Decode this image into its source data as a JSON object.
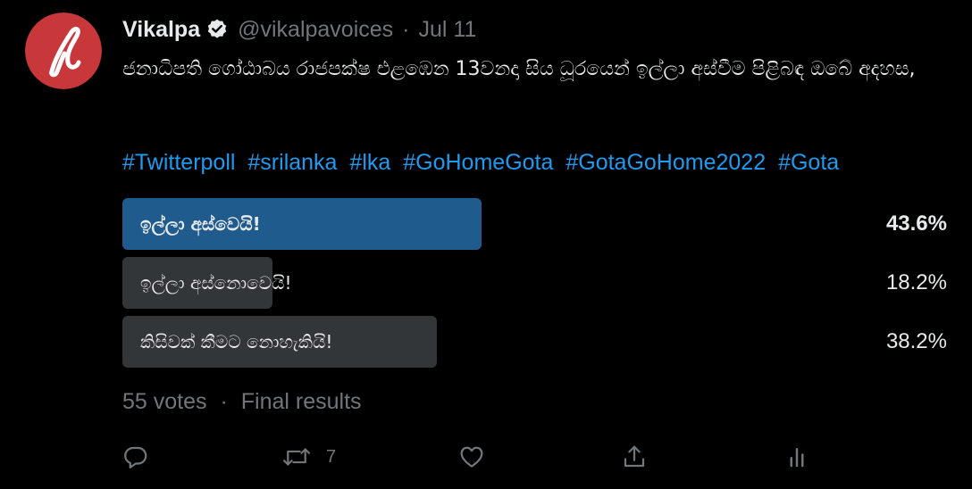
{
  "account": {
    "name": "Vikalpa",
    "handle": "@vikalpavoices",
    "separator": "·",
    "date": "Jul 11",
    "verified": true,
    "avatar_color": "#c8373a"
  },
  "tweet": {
    "text": "ජනාධිපති ගෝඨාබය රාජපක්ෂ  එළඹෙන 13වනදා සිය ධූරයෙන් ඉල්ලා අස්වීම පිළිබඳ ඔබේ අදහස,",
    "hashtags": [
      "#Twitterpoll",
      "#srilanka",
      "#lka",
      "#GoHomeGota",
      "#GotaGoHome2022",
      "#Gota"
    ]
  },
  "poll": {
    "options": [
      {
        "label": "ඉල්ලා අස්වෙයි!",
        "percent_label": "43.6%",
        "percent": 43.6,
        "winner": true
      },
      {
        "label": "ඉල්ලා අස්නොවෙයි!",
        "percent_label": "18.2%",
        "percent": 18.2,
        "winner": false
      },
      {
        "label": "කිසිවක් කීමට නොහැකියි!",
        "percent_label": "38.2%",
        "percent": 38.2,
        "winner": false
      }
    ],
    "votes": "55 votes",
    "separator": "·",
    "status": "Final results"
  },
  "actions": {
    "reply_icon": "reply-icon",
    "retweet_icon": "retweet-icon",
    "retweet_count": "7",
    "like_icon": "heart-icon",
    "share_icon": "share-icon",
    "analytics_icon": "analytics-icon"
  },
  "colors": {
    "background": "#000000",
    "text": "#e7e9ea",
    "secondary": "#71767b",
    "link": "#1d9bf0",
    "winner_bar": "#1f5b8c",
    "bar": "#333639"
  }
}
